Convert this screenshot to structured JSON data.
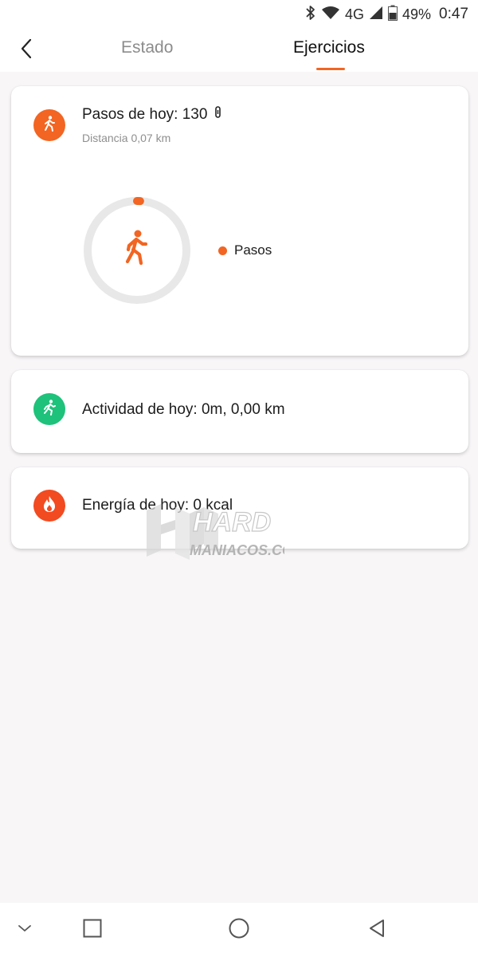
{
  "status_bar": {
    "network": "4G",
    "battery": "49%",
    "time": "0:47",
    "icons": [
      "bluetooth-icon",
      "wifi-icon",
      "cell-signal-icon",
      "battery-icon"
    ]
  },
  "header": {
    "back_icon": "chevron-left-icon",
    "tabs": [
      {
        "label": "Estado",
        "active": false
      },
      {
        "label": "Ejercicios",
        "active": true
      }
    ]
  },
  "cards": {
    "steps": {
      "icon": "walking-icon",
      "title": "Pasos de hoy: 130",
      "title_suffix_icon": "band-icon",
      "subtitle": "Distancia 0,07 km",
      "ring_progress": 0.02,
      "legend_label": "Pasos"
    },
    "activity": {
      "icon": "running-icon",
      "title": "Actividad de hoy: 0m, 0,00 km"
    },
    "energy": {
      "icon": "flame-icon",
      "title": "Energía de hoy: 0 kcal"
    }
  },
  "watermark": {
    "line1": "HARD",
    "line2": "MANIACOS.COM",
    "logo_letters": "HM"
  },
  "nav_bar": {
    "buttons": [
      "chevron-down-icon",
      "recents-square-icon",
      "home-circle-icon",
      "back-triangle-icon"
    ]
  },
  "colors": {
    "accent": "#f26522",
    "activity_green": "#1ec27a",
    "energy_red": "#f24a21",
    "ring_track": "#e8e8e8",
    "background": "#f8f6f7"
  }
}
